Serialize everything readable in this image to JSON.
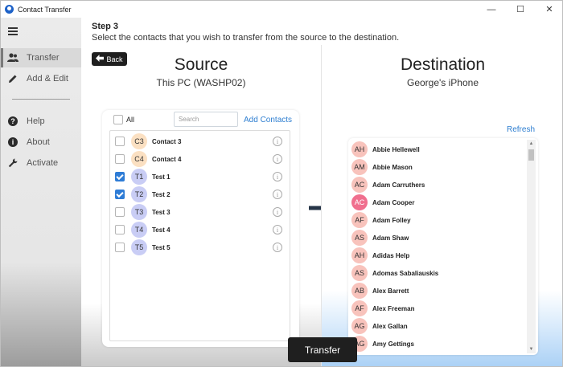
{
  "window": {
    "title": "Contact Transfer",
    "minimize": "—",
    "maximize": "☐",
    "close": "✕"
  },
  "sidebar": {
    "items": [
      {
        "label": "Transfer",
        "icon": "users-icon"
      },
      {
        "label": "Add & Edit",
        "icon": "pencil-icon"
      },
      {
        "label": "Help",
        "icon": "help-icon"
      },
      {
        "label": "About",
        "icon": "info-icon"
      },
      {
        "label": "Activate",
        "icon": "wrench-icon"
      }
    ]
  },
  "step": {
    "title": "Step 3",
    "description": "Select the contacts that you wish to transfer from the source to the destination."
  },
  "source": {
    "back_label": "Back",
    "heading": "Source",
    "device": "This PC (WASHP02)",
    "all_label": "All",
    "search_placeholder": "Search",
    "add_contacts_label": "Add Contacts",
    "contacts": [
      {
        "initials": "C3",
        "name": "Contact 3",
        "checked": false,
        "color": "#fbe0c2"
      },
      {
        "initials": "C4",
        "name": "Contact 4",
        "checked": false,
        "color": "#fbe0c2"
      },
      {
        "initials": "T1",
        "name": "Test 1",
        "checked": true,
        "color": "#c9cdf5"
      },
      {
        "initials": "T2",
        "name": "Test 2",
        "checked": true,
        "color": "#c9cdf5"
      },
      {
        "initials": "T3",
        "name": "Test 3",
        "checked": false,
        "color": "#c9cdf5"
      },
      {
        "initials": "T4",
        "name": "Test 4",
        "checked": false,
        "color": "#c9cdf5"
      },
      {
        "initials": "T5",
        "name": "Test 5",
        "checked": false,
        "color": "#c9cdf5"
      }
    ]
  },
  "destination": {
    "heading": "Destination",
    "device": "George's iPhone",
    "refresh_label": "Refresh",
    "contacts": [
      {
        "initials": "AH",
        "name": "Abbie Hellewell",
        "color": "#f8c3bc"
      },
      {
        "initials": "AM",
        "name": "Abbie Mason",
        "color": "#f8c3bc"
      },
      {
        "initials": "AC",
        "name": "Adam Carruthers",
        "color": "#f8c3bc"
      },
      {
        "initials": "AC",
        "name": "Adam Cooper",
        "color": "#f06f8e"
      },
      {
        "initials": "AF",
        "name": "Adam Folley",
        "color": "#f8c3bc"
      },
      {
        "initials": "AS",
        "name": "Adam Shaw",
        "color": "#f8c3bc"
      },
      {
        "initials": "AH",
        "name": "Adidas Help",
        "color": "#f8c3bc"
      },
      {
        "initials": "AS",
        "name": "Adomas Sabaliauskis",
        "color": "#f8c3bc"
      },
      {
        "initials": "AB",
        "name": "Alex Barrett",
        "color": "#f8c3bc"
      },
      {
        "initials": "AF",
        "name": "Alex Freeman",
        "color": "#f8c3bc"
      },
      {
        "initials": "AG",
        "name": "Alex Gallan",
        "color": "#f8c3bc"
      },
      {
        "initials": "AG",
        "name": "Amy Gettings",
        "color": "#f8c3bc"
      }
    ]
  },
  "transfer_label": "Transfer"
}
